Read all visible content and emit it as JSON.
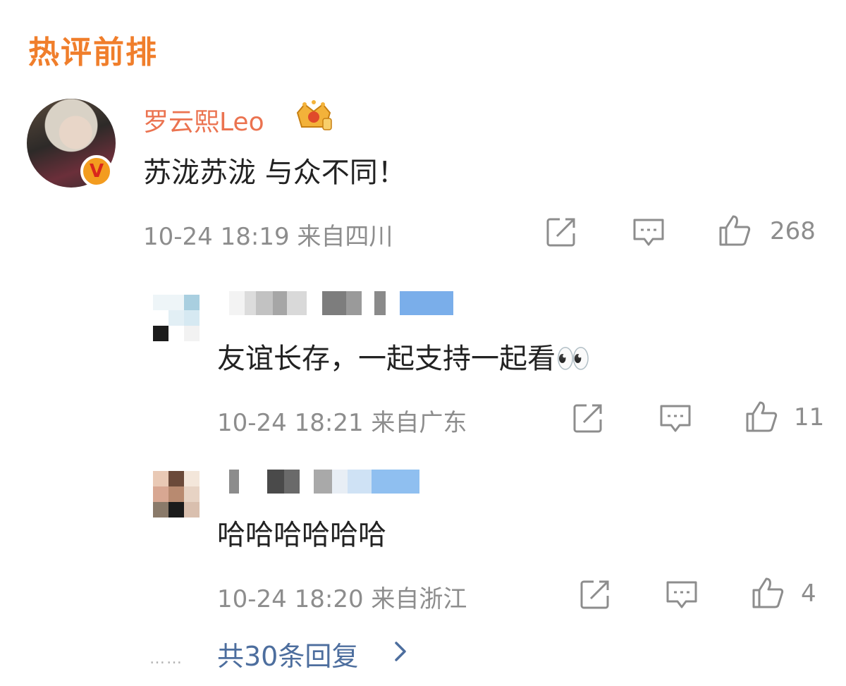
{
  "section_title": "热评前排",
  "main_comment": {
    "author": "罗云熙Leo",
    "text": "苏泷苏泷 与众不同！",
    "time": "10-24 18:19",
    "location": "来自四川",
    "like_count": "268",
    "icons": [
      "share-icon",
      "comment-icon",
      "like-icon"
    ],
    "badge_icon": "crown-badge-icon",
    "verified_mark": "V"
  },
  "replies": [
    {
      "text": "友谊长存，一起支持一起看👀",
      "time": "10-24 18:21",
      "location": "来自广东",
      "like_count": "11",
      "name_badge": "2"
    },
    {
      "text": "哈哈哈哈哈哈",
      "time": "10-24 18:20",
      "location": "来自浙江",
      "like_count": "4"
    }
  ],
  "more_dots": "……",
  "more_replies_label": "共30条回复",
  "colors": {
    "accent_orange": "#f07e2b",
    "username": "#eb7350",
    "meta_gray": "#8d8d8d",
    "link_blue": "#4d6e9e"
  }
}
